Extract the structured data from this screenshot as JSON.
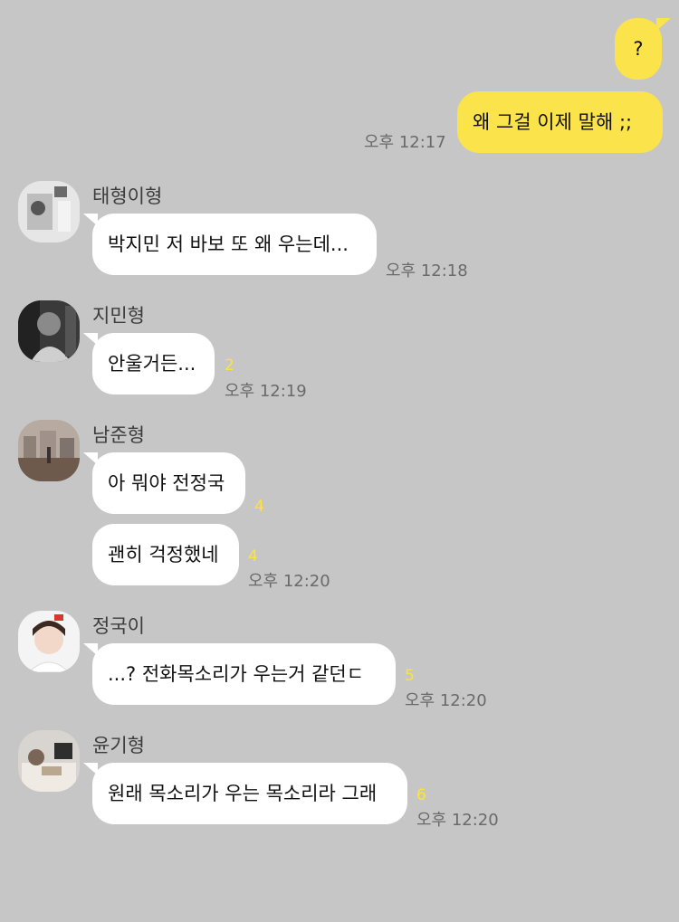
{
  "messages": {
    "me1": {
      "text": "?"
    },
    "me2": {
      "text": "왜 그걸 이제 말해 ;;",
      "time": "오후 12:17"
    },
    "taehyung": {
      "sender": "태형이형",
      "text": "박지민 저 바보 또 왜 우는데...",
      "time": "오후 12:18"
    },
    "jimin": {
      "sender": "지민형",
      "text": "안울거든...",
      "unread": "2",
      "time": "오후 12:19"
    },
    "namjoon": {
      "sender": "남준형",
      "text1": "아 뭐야 전정국",
      "unread1": "4",
      "text2": "괜히 걱정했네",
      "unread2": "4",
      "time": "오후 12:20"
    },
    "jungkook": {
      "sender": "정국이",
      "text": "...? 전화목소리가 우는거 같던ㄷ",
      "unread": "5",
      "time": "오후 12:20"
    },
    "yoongi": {
      "sender": "윤기형",
      "text": "원래 목소리가 우는 목소리라 그래",
      "unread": "6",
      "time": "오후 12:20"
    }
  },
  "colors": {
    "background": "#c6c6c6",
    "my_bubble": "#fae34b",
    "their_bubble": "#ffffff",
    "unread": "#fde33b"
  }
}
